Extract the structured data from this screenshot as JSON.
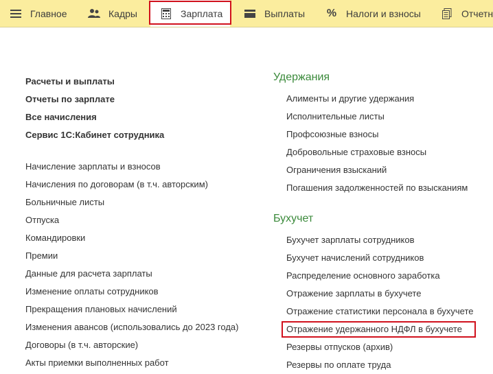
{
  "topbar": {
    "tabs": [
      {
        "label": "Главное",
        "icon": "hamburger-menu-icon"
      },
      {
        "label": "Кадры",
        "icon": "people-icon"
      },
      {
        "label": "Зарплата",
        "icon": "calculator-icon",
        "active": true
      },
      {
        "label": "Выплаты",
        "icon": "credit-card-icon"
      },
      {
        "label": "Налоги и взносы",
        "icon": "percent-icon"
      },
      {
        "label": "Отчетн",
        "icon": "documents-icon"
      }
    ]
  },
  "left_column": {
    "primary_links": [
      "Расчеты и выплаты",
      "Отчеты по зарплате",
      "Все начисления",
      "Сервис 1С:Кабинет сотрудника"
    ],
    "links": [
      "Начисление зарплаты и взносов",
      "Начисления по договорам (в т.ч. авторским)",
      "Больничные листы",
      "Отпуска",
      "Командировки",
      "Премии",
      "Данные для расчета зарплаты",
      "Изменение оплаты сотрудников",
      "Прекращения плановых начислений",
      "Изменения авансов (использовались до 2023 года)",
      "Договоры (в т.ч. авторские)",
      "Акты приемки выполненных работ"
    ]
  },
  "right_column": {
    "deductions": {
      "title": "Удержания",
      "links": [
        "Алименты и другие удержания",
        "Исполнительные листы",
        "Профсоюзные взносы",
        "Добровольные страховые взносы",
        "Ограничения взысканий",
        "Погашения задолженностей по взысканиям"
      ]
    },
    "accounting": {
      "title": "Бухучет",
      "links": [
        "Бухучет зарплаты сотрудников",
        "Бухучет начислений сотрудников",
        "Распределение основного заработка",
        "Отражение зарплаты в бухучете",
        "Отражение статистики персонала в бухучете",
        "Отражение удержанного НДФЛ в бухучете",
        "Резервы отпусков (архив)",
        "Резервы по оплате труда"
      ]
    }
  },
  "colors": {
    "topbar_bg": "#fbed9e",
    "section_title": "#3b8a3b",
    "highlight": "#d0101c"
  }
}
